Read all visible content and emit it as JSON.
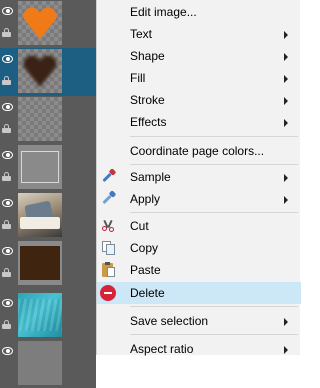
{
  "layers": [
    {
      "id": "layer-heart-orange",
      "thumb": "orange-heart",
      "selected": false
    },
    {
      "id": "layer-heart-dark",
      "thumb": "dark-heart",
      "selected": true
    },
    {
      "id": "layer-blank",
      "thumb": "checker",
      "selected": false
    },
    {
      "id": "layer-frame",
      "thumb": "frame",
      "selected": false
    },
    {
      "id": "layer-photo",
      "thumb": "photo",
      "selected": false
    },
    {
      "id": "layer-brown",
      "thumb": "brown",
      "selected": false
    },
    {
      "id": "layer-teal",
      "thumb": "teal",
      "selected": false
    },
    {
      "id": "layer-gray",
      "thumb": "gray",
      "selected": false
    }
  ],
  "menu": {
    "edit_image": "Edit image...",
    "text": "Text",
    "shape": "Shape",
    "fill": "Fill",
    "stroke": "Stroke",
    "effects": "Effects",
    "coordinate_colors": "Coordinate page colors...",
    "sample": "Sample",
    "apply": "Apply",
    "cut": "Cut",
    "copy": "Copy",
    "paste": "Paste",
    "delete": "Delete",
    "save_selection": "Save selection",
    "aspect_ratio": "Aspect ratio"
  },
  "colors": {
    "panel_bg": "#5a5a5a",
    "selected_layer": "#1d5f83",
    "menu_bg": "#f2f2f2",
    "hover": "#cce8f6",
    "orange_heart": "#f07a18",
    "dark_heart": "#3a2416"
  }
}
